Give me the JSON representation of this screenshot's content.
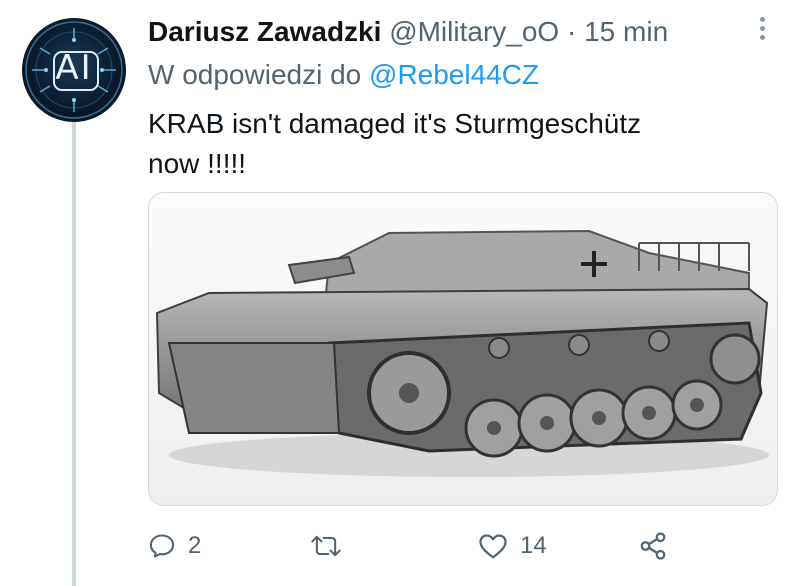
{
  "author": {
    "name": "Dariusz Zawadzki",
    "handle": "@Military_oO",
    "separator": "·",
    "time": "15 min",
    "avatar_text": "AI"
  },
  "reply": {
    "prefix": "W odpowiedzi do",
    "mention": "@Rebel44CZ"
  },
  "tweet": {
    "text_line1": "KRAB isn't damaged it's Sturmgeschütz",
    "text_line2": "now !!!!!"
  },
  "media": {
    "description_icon": "tank-photo"
  },
  "actions": {
    "reply_count": "2",
    "retweet_count": "",
    "like_count": "14",
    "share_count": ""
  },
  "colors": {
    "text": "#0f1419",
    "secondary": "#536471",
    "link": "#1d9bf0",
    "border": "#cfd9de"
  },
  "icons": [
    "more-vertical-icon",
    "reply-icon",
    "retweet-icon",
    "like-icon",
    "share-icon"
  ]
}
